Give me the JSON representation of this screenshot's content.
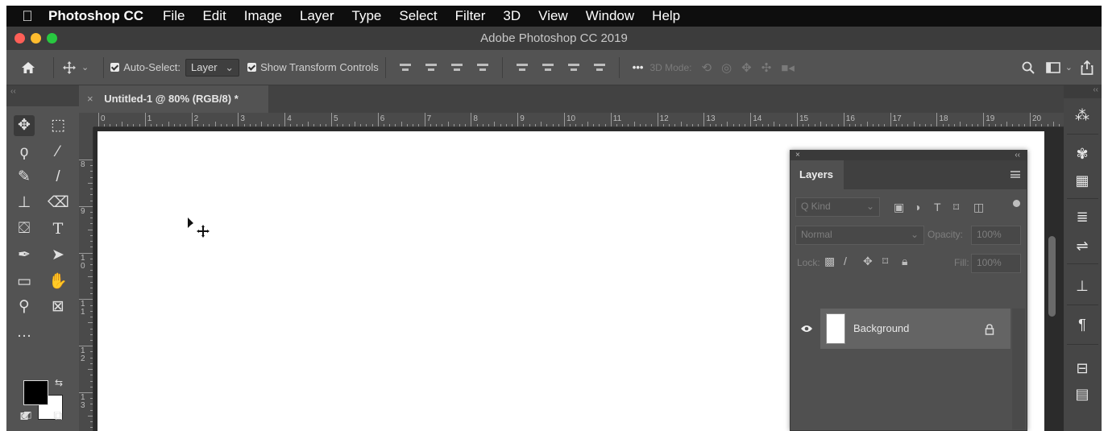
{
  "menubar": {
    "apple": "",
    "app_name": "Photoshop CC",
    "items": [
      "File",
      "Edit",
      "Image",
      "Layer",
      "Type",
      "Select",
      "Filter",
      "3D",
      "View",
      "Window",
      "Help"
    ]
  },
  "window": {
    "title": "Adobe Photoshop CC 2019",
    "traffic_colors": [
      "#fe5f57",
      "#febc2e",
      "#28c840"
    ]
  },
  "options_bar": {
    "home_icon": "home-icon",
    "auto_select_label": "Auto-Select:",
    "auto_select_value": "Layer",
    "show_transform_label": "Show Transform Controls",
    "more_label": "•••",
    "mode_3d_label": "3D Mode:"
  },
  "toolbar": {
    "header": "‹‹"
  },
  "document": {
    "tab_title": "Untitled-1 @ 80% (RGB/8) *",
    "tab_close": "×",
    "ruler_top": [
      "0",
      "1",
      "2",
      "3",
      "4",
      "5",
      "6",
      "7",
      "8",
      "9",
      "10",
      "11",
      "12",
      "13",
      "14",
      "15",
      "16",
      "17",
      "18",
      "19",
      "20"
    ],
    "ruler_left": [
      "8",
      "9",
      "1\n0",
      "1\n1",
      "1\n2",
      "1\n3"
    ]
  },
  "right_dock": {
    "header": "‹‹"
  },
  "layers_panel": {
    "close": "×",
    "collapse": "‹‹",
    "tab_label": "Layers",
    "kind_placeholder": "Q Kind",
    "blend_mode": "Normal",
    "opacity_label": "Opacity:",
    "opacity_value": "100%",
    "lock_label": "Lock:",
    "fill_label": "Fill:",
    "fill_value": "100%",
    "layers": [
      {
        "name": "Background",
        "visible": true,
        "locked": true
      }
    ]
  },
  "colors": {
    "app_bg": "#535353",
    "panel_dark": "#424242",
    "canvas_bg": "#ffffff",
    "foreground": "#000000",
    "background": "#ffffff"
  }
}
